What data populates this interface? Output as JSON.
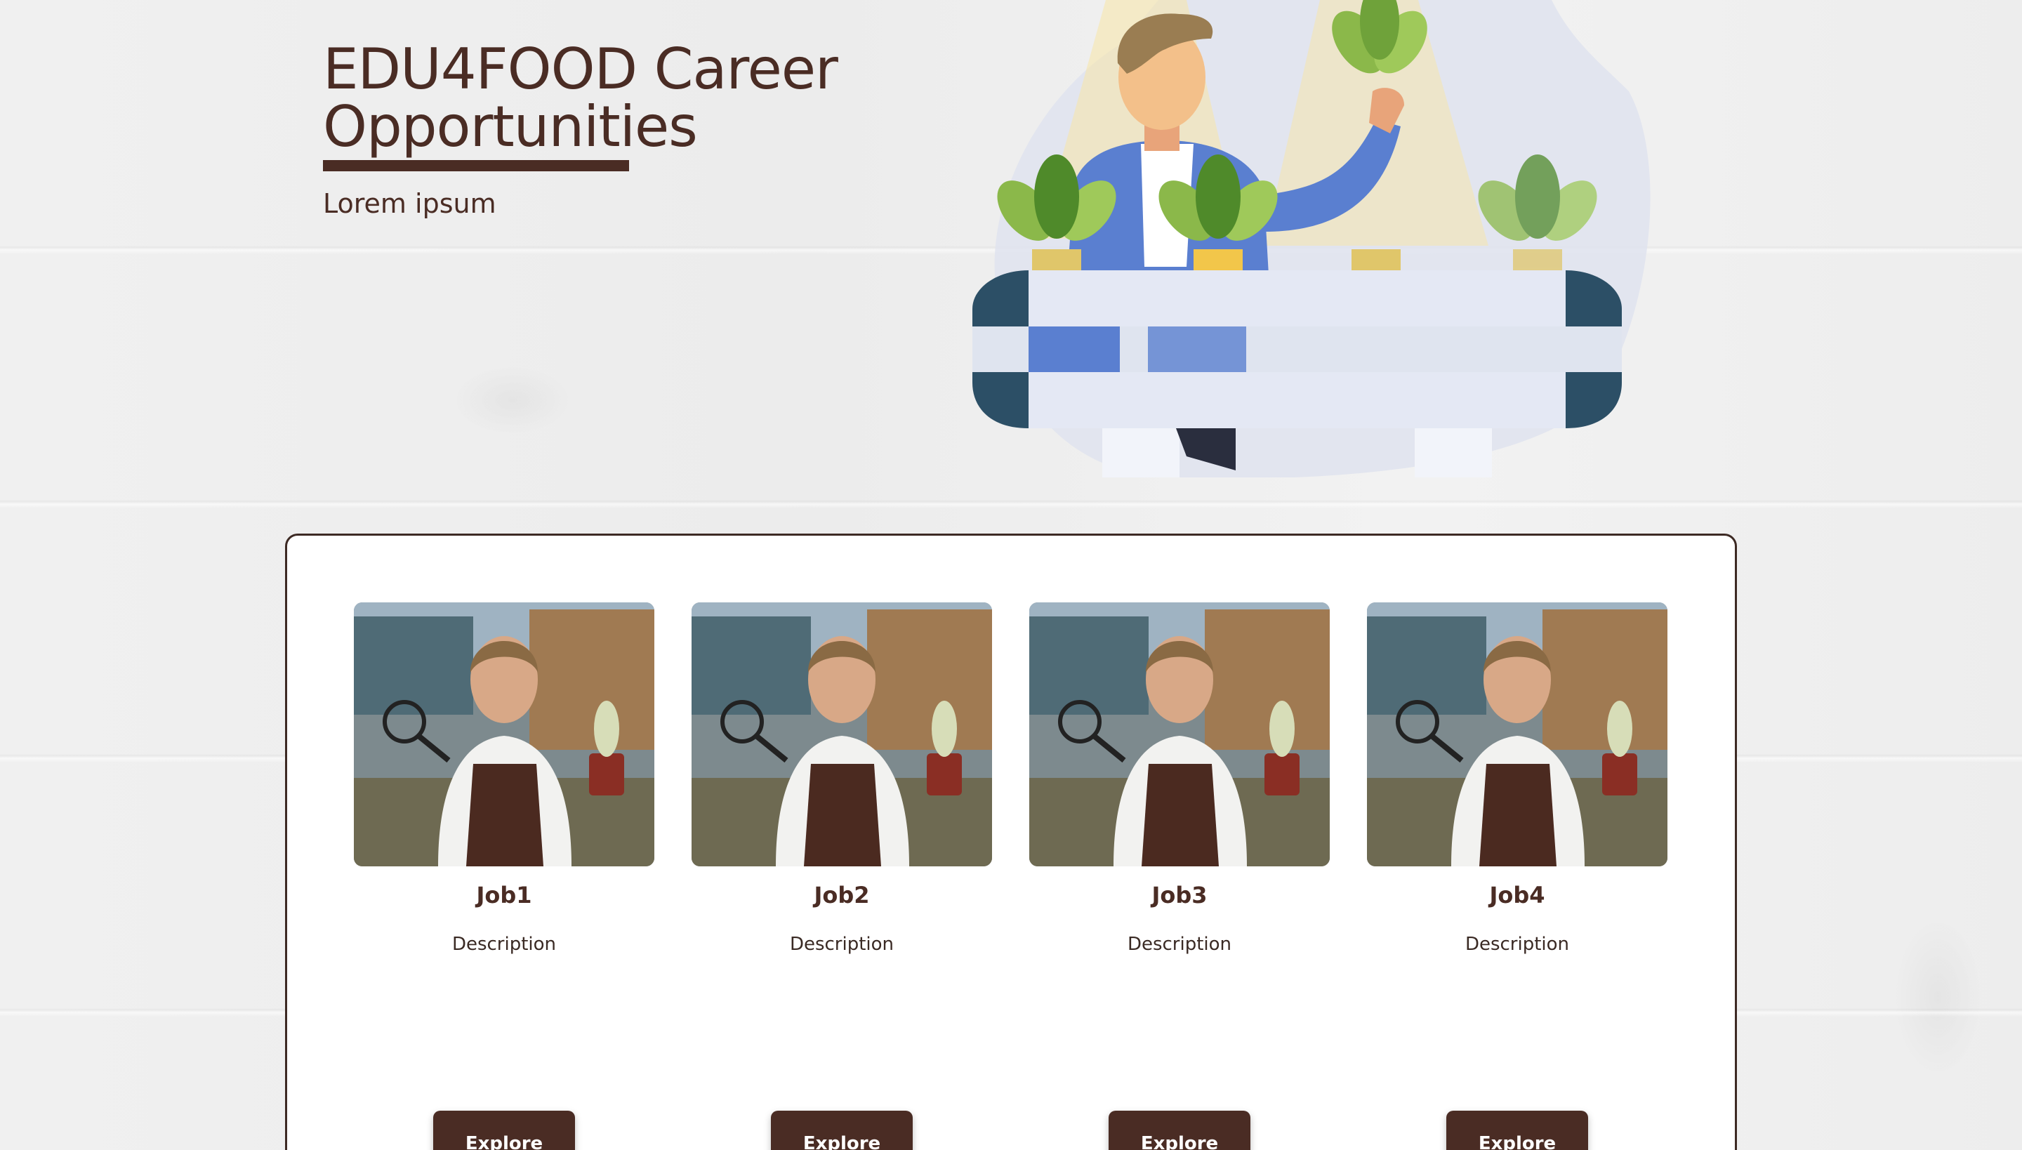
{
  "hero": {
    "title_line1": "EDU4FOOD Career",
    "title_line2": "Opportunities",
    "subtitle": "Lorem ipsum"
  },
  "jobs": [
    {
      "title": "Job1",
      "description": "Description",
      "button": "Explore"
    },
    {
      "title": "Job2",
      "description": "Description",
      "button": "Explore"
    },
    {
      "title": "Job3",
      "description": "Description",
      "button": "Explore"
    },
    {
      "title": "Job4",
      "description": "Description",
      "button": "Explore"
    }
  ],
  "colors": {
    "brand": "#4a2c24",
    "background": "#efefef",
    "panel": "#ffffff"
  },
  "icons": {
    "hero_illustration": "gardener-with-plants-illustration",
    "job_photo": "woman-greenhouse-photo"
  }
}
